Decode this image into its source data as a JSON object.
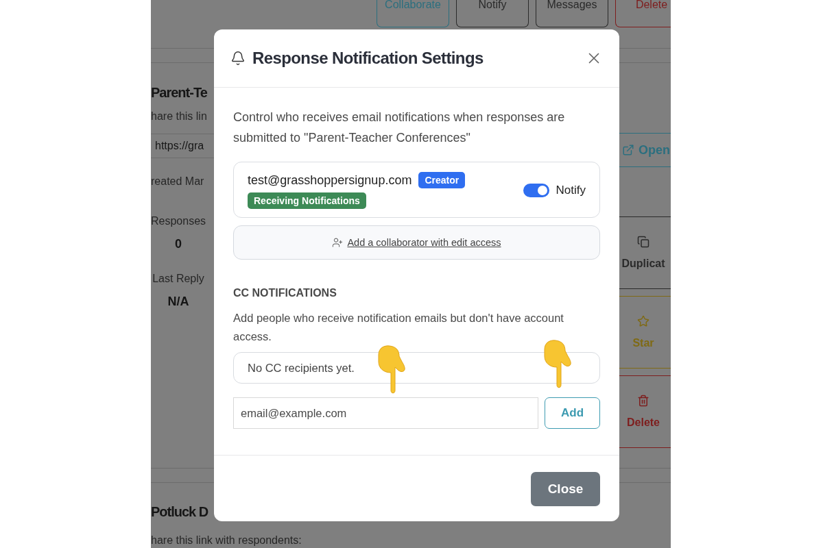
{
  "background_page": {
    "top_buttons": [
      {
        "label": "Collaborate",
        "kind": "primary"
      },
      {
        "label": "Notify",
        "kind": "default"
      },
      {
        "label": "Messages",
        "kind": "default"
      },
      {
        "label": "Delete",
        "kind": "danger"
      }
    ],
    "form_title": "Parent-Te",
    "share_label": "hare this lin",
    "link": "https://gra",
    "created": "reated Mar",
    "stats": [
      {
        "label": "Responses",
        "value": "0"
      },
      {
        "label": "Last Reply",
        "value": "N/A"
      }
    ],
    "open_button": "Open",
    "actions": [
      {
        "label": "Duplicat",
        "kind": "duplicate"
      },
      {
        "label": "Star",
        "kind": "star"
      },
      {
        "label": "Delete",
        "kind": "delete"
      }
    ],
    "next_form": {
      "title": "Potluck D",
      "share_label": "hare this link with respondents:"
    }
  },
  "dialog": {
    "title": "Response Notification Settings",
    "description": "Control who receives email notifications when responses are submitted to \"Parent-Teacher Conferences\"",
    "recipients": [
      {
        "email": "test@grasshoppersignup.com",
        "role": "Creator",
        "status": "Receiving Notifications",
        "notify": {
          "label": "Notify",
          "on": true
        }
      }
    ],
    "add_collaborator_link": "Add a collaborator with edit access",
    "cc": {
      "heading": "CC NOTIFICATIONS",
      "help": "Add people who receive notification emails but don't have account access.",
      "empty_text": "No CC recipients yet.",
      "email_field": {
        "placeholder": "email@example.com"
      },
      "add_button": "Add"
    },
    "close_button": "Close"
  }
}
